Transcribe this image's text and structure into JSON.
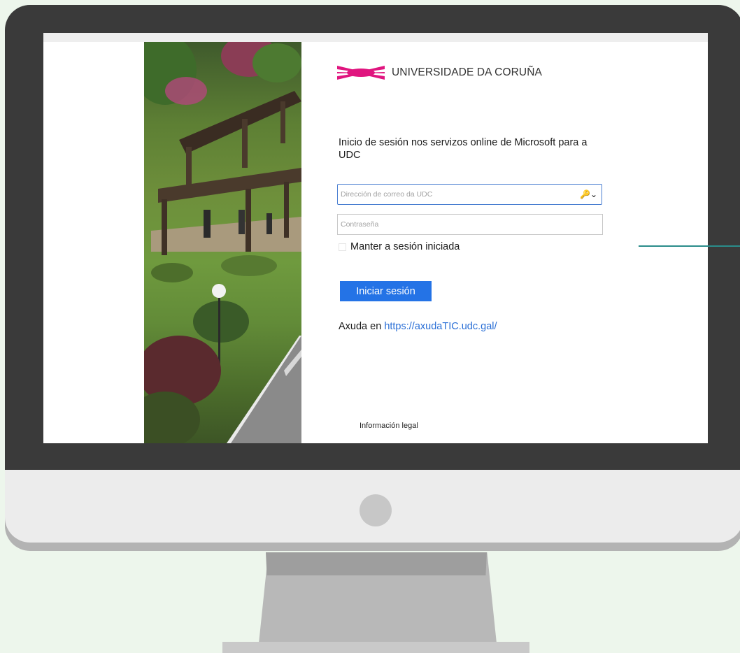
{
  "colors": {
    "page_background": "#edf6ec",
    "bezel": "#3a3a3a",
    "accent_button": "#2473e6",
    "link": "#2a6fd6",
    "logo_pink": "#e0157f",
    "pointer_line": "#2a8c8a"
  },
  "logo": {
    "text": "UNIVERSIDADE DA CORUÑA",
    "icon": "udc-logo-icon"
  },
  "login": {
    "title": "Inicio de sesión nos servizos online de Microsoft para a UDC",
    "email_placeholder": "Dirección de correo da UDC",
    "email_value": "",
    "email_icon": "key-chevron-icon",
    "password_placeholder": "Contraseña",
    "password_value": "",
    "remember_label": "Manter a sesión iniciada",
    "remember_checked": false,
    "signin_label": "Iniciar sesión"
  },
  "help": {
    "prefix": "Axuda en ",
    "link_text": "https://axudaTIC.udc.gal/"
  },
  "footer": {
    "legal_label": "Información legal"
  }
}
